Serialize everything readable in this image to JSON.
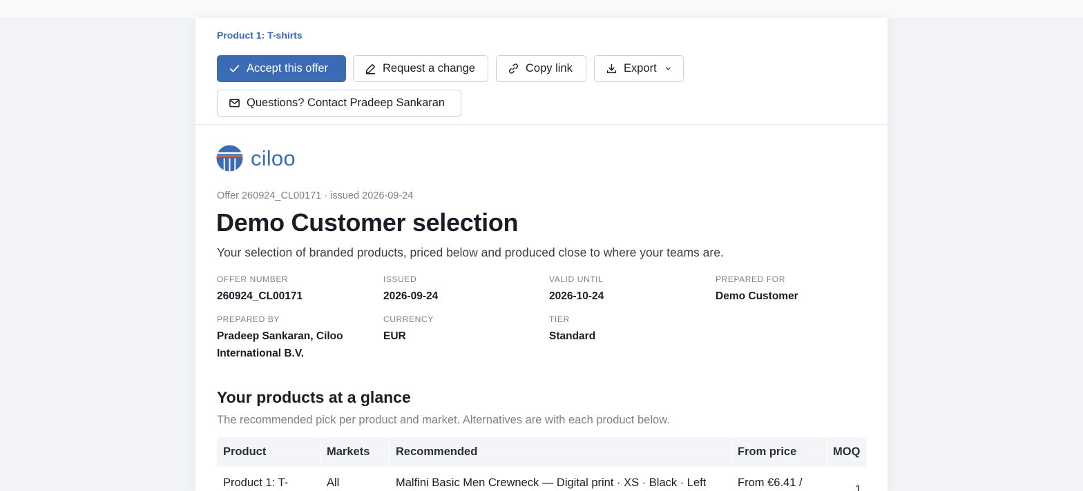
{
  "breadcrumb": "Product 1: T-shirts",
  "actions": {
    "accept": "Accept this offer",
    "request_change": "Request a change",
    "copy_link": "Copy link",
    "export": "Export",
    "contact": "Questions? Contact Pradeep Sankaran"
  },
  "brand": {
    "name": "ciloo",
    "color": "#3b6bb5",
    "accent": "#e8622c"
  },
  "offer_line": "Offer 260924_CL00171 · issued 2026-09-24",
  "title": "Demo Customer selection",
  "intro": "Your selection of branded products, priced below and produced close to where your teams are.",
  "meta": [
    {
      "label": "OFFER NUMBER",
      "value": "260924_CL00171"
    },
    {
      "label": "ISSUED",
      "value": "2026-09-24"
    },
    {
      "label": "VALID UNTIL",
      "value": "2026-10-24"
    },
    {
      "label": "PREPARED FOR",
      "value": "Demo Customer"
    },
    {
      "label": "PREPARED BY",
      "value": "Pradeep Sankaran, Ciloo International B.V."
    },
    {
      "label": "CURRENCY",
      "value": "EUR"
    },
    {
      "label": "TIER",
      "value": "Standard"
    }
  ],
  "glance": {
    "heading": "Your products at a glance",
    "subtitle": "The recommended pick per product and market. Alternatives are with each product below.",
    "columns": [
      "Product",
      "Markets",
      "Recommended",
      "From price",
      "MOQ"
    ],
    "rows": [
      {
        "product": "Product 1: T-",
        "markets": "All",
        "recommended": "Malfini Basic Men Crewneck — Digital print · XS · Black · Left",
        "price": "From €6.41 /",
        "moq": "1"
      }
    ]
  }
}
